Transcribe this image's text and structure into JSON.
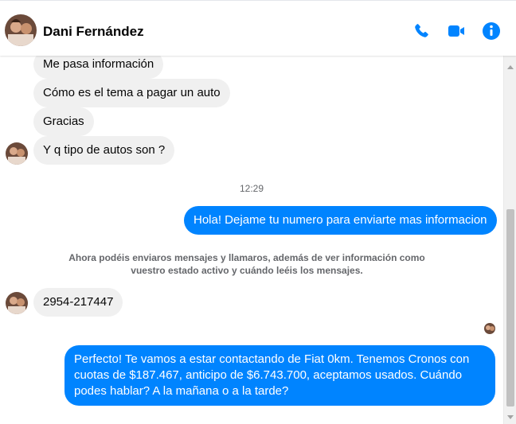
{
  "header": {
    "contact_name": "Dani Fernández",
    "icons": {
      "avatar": "profile-photo",
      "call": "phone-icon",
      "video": "video-camera-icon",
      "info": "info-icon"
    },
    "accent_color": "#0084ff"
  },
  "messages": [
    {
      "side": "in",
      "text": "Me pasa información"
    },
    {
      "side": "in",
      "text": "Cómo es el tema a pagar un auto"
    },
    {
      "side": "in",
      "text": "Gracias"
    },
    {
      "side": "in",
      "text": "Y q tipo de autos son ?"
    },
    {
      "side": "time",
      "text": "12:29"
    },
    {
      "side": "out",
      "text": "Hola! Dejame tu numero para enviarte mas informacion"
    },
    {
      "side": "notice",
      "text": "Ahora podéis enviaros mensajes y llamaros, además de ver información como vuestro estado activo y cuándo leéis los mensajes."
    },
    {
      "side": "in",
      "text": "2954-217447"
    },
    {
      "side": "out",
      "text": "Perfecto! Te vamos a estar contactando de Fiat 0km. Tenemos Cronos con cuotas de $187.467, anticipo de $6.743.700, aceptamos usados. Cuándo podes hablar? A la mañana o a la tarde?"
    }
  ]
}
